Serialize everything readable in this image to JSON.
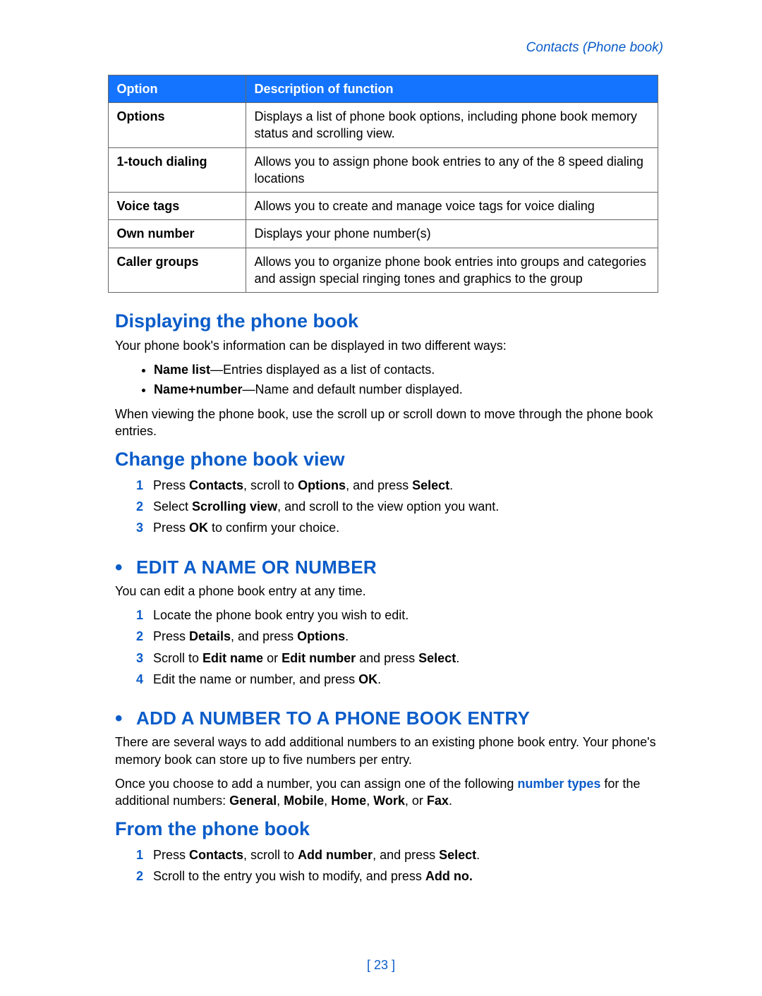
{
  "header": {
    "breadcrumb": "Contacts (Phone book)"
  },
  "table": {
    "head": {
      "option": "Option",
      "desc": "Description of function"
    },
    "rows": [
      {
        "option": "Options",
        "desc": "Displays a list of phone book options, including phone book memory status and scrolling view."
      },
      {
        "option": "1-touch dialing",
        "desc": "Allows you to assign phone book entries to any of the 8 speed dialing locations"
      },
      {
        "option": "Voice tags",
        "desc": "Allows you to create and manage voice tags for voice dialing"
      },
      {
        "option": "Own number",
        "desc": "Displays your phone number(s)"
      },
      {
        "option": "Caller groups",
        "desc": "Allows you to organize phone book entries into groups and categories and assign special ringing tones and graphics to the group"
      }
    ]
  },
  "section1": {
    "heading": "Displaying the phone book",
    "intro": "Your phone book's information can be displayed in two different ways:",
    "bullets": {
      "b1_label": "Name list",
      "b1_text": "—Entries displayed as a list of contacts.",
      "b2_label": "Name+number",
      "b2_text": "—Name and default number displayed."
    },
    "outro": "When viewing the phone book, use the scroll up or scroll down to move through the phone book entries."
  },
  "section2": {
    "heading": "Change phone book view",
    "steps": {
      "s1a": "Press ",
      "s1b": "Contacts",
      "s1c": ", scroll to ",
      "s1d": "Options",
      "s1e": ", and press ",
      "s1f": "Select",
      "s1g": ".",
      "s2a": "Select ",
      "s2b": "Scrolling view",
      "s2c": ", and scroll to the view option you want.",
      "s3a": "Press ",
      "s3b": "OK",
      "s3c": " to confirm your choice."
    }
  },
  "section3": {
    "heading": "EDIT A NAME OR NUMBER",
    "intro": "You can edit a phone book entry at any time.",
    "steps": {
      "s1": "Locate the phone book entry you wish to edit.",
      "s2a": "Press ",
      "s2b": "Details",
      "s2c": ", and press ",
      "s2d": "Options",
      "s2e": ".",
      "s3a": "Scroll to ",
      "s3b": "Edit name",
      "s3c": " or ",
      "s3d": "Edit number",
      "s3e": " and press ",
      "s3f": "Select",
      "s3g": ".",
      "s4a": "Edit the name or number, and press ",
      "s4b": "OK",
      "s4c": "."
    }
  },
  "section4": {
    "heading": "ADD A NUMBER TO A PHONE BOOK ENTRY",
    "p1": "There are several ways to add additional numbers to an existing phone book entry. Your phone's memory book can store up to five numbers per entry.",
    "p2a": "Once you choose to add a number, you can assign one of the following ",
    "p2b": "number types",
    "p2c": " for the additional numbers: ",
    "p2d": "General",
    "p2e": ", ",
    "p2f": "Mobile",
    "p2g": ", ",
    "p2h": "Home",
    "p2i": ", ",
    "p2j": "Work",
    "p2k": ", or ",
    "p2l": "Fax",
    "p2m": "."
  },
  "section5": {
    "heading": "From the phone book",
    "steps": {
      "s1a": "Press ",
      "s1b": "Contacts",
      "s1c": ", scroll to ",
      "s1d": "Add number",
      "s1e": ", and press ",
      "s1f": "Select",
      "s1g": ".",
      "s2a": "Scroll to the entry you wish to modify, and press ",
      "s2b": "Add no.",
      "s2c": ""
    }
  },
  "page_number": "[ 23 ]",
  "nums": {
    "n1": "1",
    "n2": "2",
    "n3": "3",
    "n4": "4"
  }
}
